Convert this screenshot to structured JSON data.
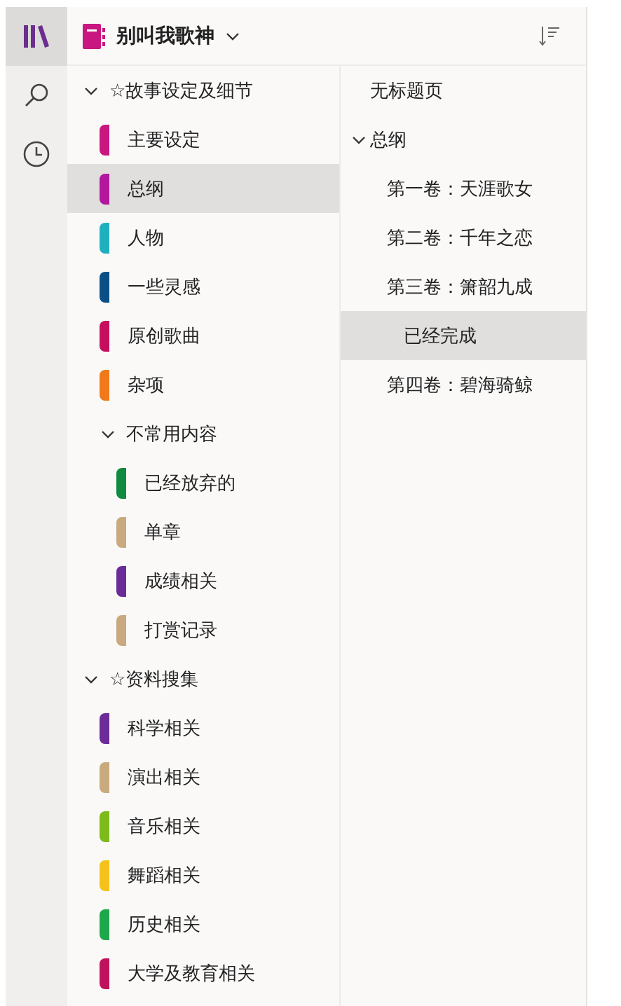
{
  "notebook": {
    "title": "别叫我歌神"
  },
  "rail": [
    {
      "kind": "notebooks",
      "selected": true
    },
    {
      "kind": "search",
      "selected": false
    },
    {
      "kind": "recent",
      "selected": false
    }
  ],
  "sections": [
    {
      "kind": "group",
      "label": "☆故事设定及细节",
      "expanded": true,
      "children": [
        {
          "kind": "section",
          "label": "主要设定",
          "color": "#c8177f",
          "selected": false
        },
        {
          "kind": "section",
          "label": "总纲",
          "color": "#b3179c",
          "selected": true
        },
        {
          "kind": "section",
          "label": "人物",
          "color": "#1fb0c0",
          "selected": false
        },
        {
          "kind": "section",
          "label": "一些灵感",
          "color": "#0a4f86",
          "selected": false
        },
        {
          "kind": "section",
          "label": "原创歌曲",
          "color": "#c70e5e",
          "selected": false
        },
        {
          "kind": "section",
          "label": "杂项",
          "color": "#f07a1a",
          "selected": false
        },
        {
          "kind": "group",
          "label": "不常用内容",
          "expanded": true,
          "children": [
            {
              "kind": "section",
              "label": "已经放弃的",
              "color": "#0f8a3e",
              "selected": false
            },
            {
              "kind": "section",
              "label": "单章",
              "color": "#c8aa7e",
              "selected": false
            },
            {
              "kind": "section",
              "label": "成绩相关",
              "color": "#6b2c99",
              "selected": false
            },
            {
              "kind": "section",
              "label": "打赏记录",
              "color": "#c8aa7e",
              "selected": false
            }
          ]
        }
      ]
    },
    {
      "kind": "group",
      "label": "☆资料搜集",
      "expanded": true,
      "children": [
        {
          "kind": "section",
          "label": "科学相关",
          "color": "#6b2c99",
          "selected": false
        },
        {
          "kind": "section",
          "label": "演出相关",
          "color": "#c8aa7e",
          "selected": false
        },
        {
          "kind": "section",
          "label": "音乐相关",
          "color": "#7cbb1a",
          "selected": false
        },
        {
          "kind": "section",
          "label": "舞蹈相关",
          "color": "#f5c21b",
          "selected": false
        },
        {
          "kind": "section",
          "label": "历史相关",
          "color": "#1ea84c",
          "selected": false
        },
        {
          "kind": "section",
          "label": "大学及教育相关",
          "color": "#c0125c",
          "selected": false
        }
      ]
    }
  ],
  "pages": [
    {
      "label": "无标题页",
      "selected": false
    },
    {
      "label": "总纲",
      "selected": false,
      "expanded": true,
      "children": [
        {
          "label": "第一卷：天涯歌女",
          "selected": false
        },
        {
          "label": "第二卷：千年之恋",
          "selected": false
        },
        {
          "label": "第三卷：箫韶九成",
          "selected": false,
          "children": [
            {
              "label": "已经完成",
              "selected": true
            }
          ]
        },
        {
          "label": "第四卷：碧海骑鲸",
          "selected": false
        }
      ]
    }
  ]
}
